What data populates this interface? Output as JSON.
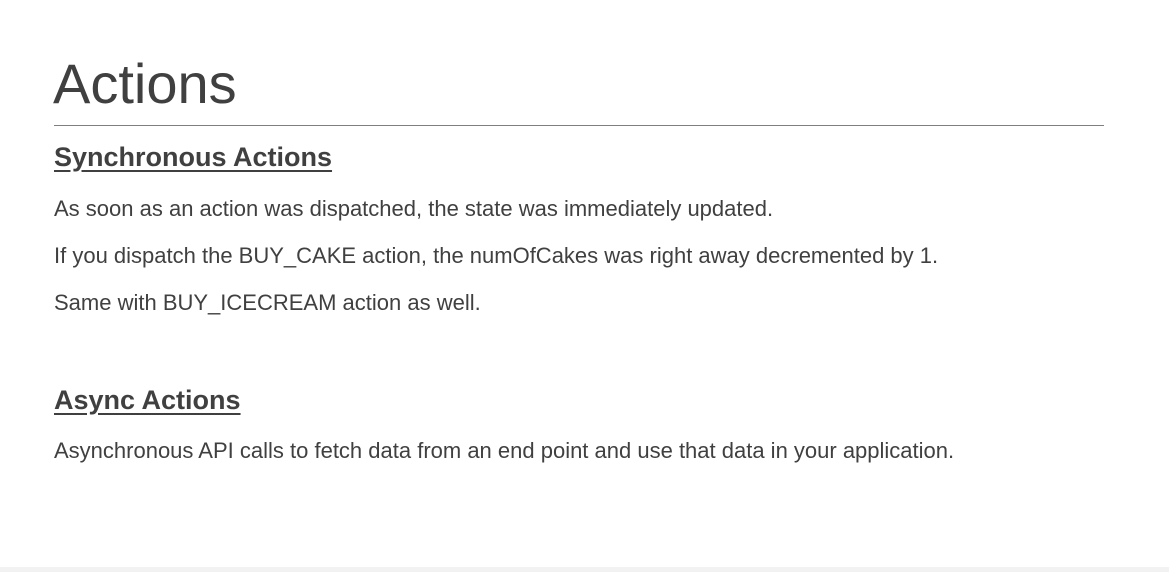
{
  "slide": {
    "title": "Actions",
    "sections": [
      {
        "heading": "Synchronous Actions",
        "paragraphs": [
          "As soon as an action was dispatched, the state was immediately updated.",
          "If you dispatch the BUY_CAKE action, the numOfCakes was right away decremented by 1.",
          "Same with BUY_ICECREAM action as well."
        ]
      },
      {
        "heading": "Async Actions",
        "paragraphs": [
          "Asynchronous API calls to fetch data from an end point and use that data in your application."
        ]
      }
    ]
  }
}
